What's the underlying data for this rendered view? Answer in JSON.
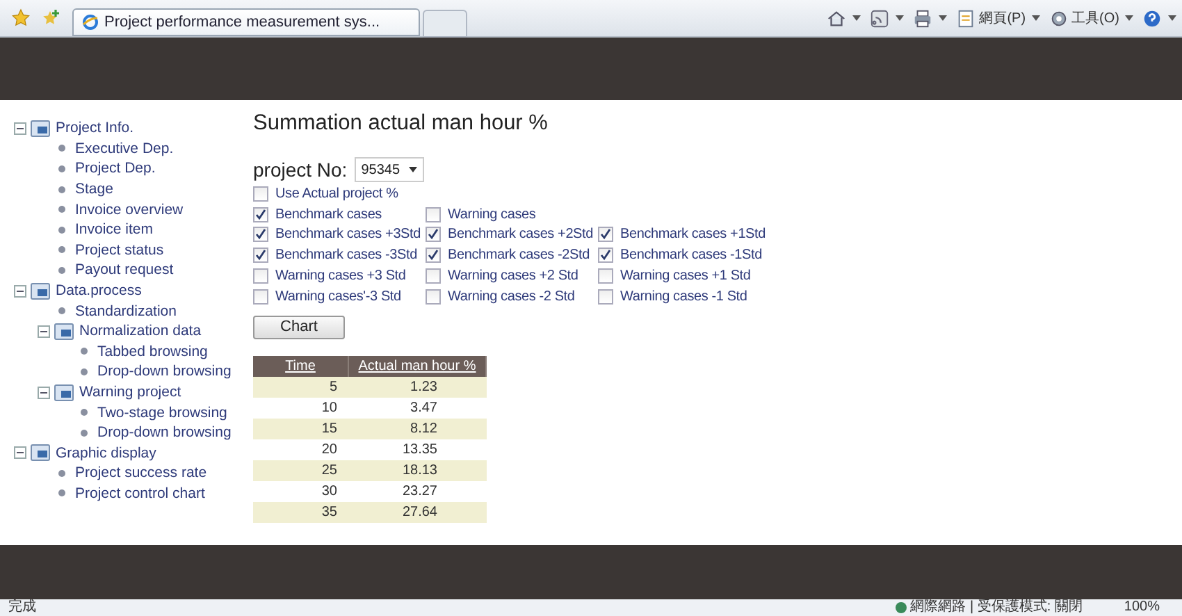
{
  "browser": {
    "tab_title": "Project performance measurement sys...",
    "tools": [
      {
        "kind": "home"
      },
      {
        "kind": "feed"
      },
      {
        "kind": "print"
      },
      {
        "kind": "page",
        "label": "網頁(P)"
      },
      {
        "kind": "tools",
        "label": "工具(O)"
      },
      {
        "kind": "help"
      }
    ]
  },
  "sidebar": {
    "items": [
      {
        "label": "Project Info.",
        "expanded": true,
        "children": [
          {
            "label": "Executive Dep."
          },
          {
            "label": "Project Dep."
          },
          {
            "label": "Stage"
          },
          {
            "label": "Invoice overview"
          },
          {
            "label": "Invoice item"
          },
          {
            "label": "Project status"
          },
          {
            "label": "Payout request"
          }
        ]
      },
      {
        "label": "Data.process",
        "expanded": true,
        "children": [
          {
            "label": "Standardization"
          },
          {
            "label": "Normalization data",
            "expanded": true,
            "children": [
              {
                "label": "Tabbed browsing"
              },
              {
                "label": "Drop-down browsing"
              }
            ]
          },
          {
            "label": "Warning project",
            "expanded": true,
            "children": [
              {
                "label": "Two-stage browsing"
              },
              {
                "label": "Drop-down browsing"
              }
            ]
          }
        ]
      },
      {
        "label": "Graphic display",
        "expanded": true,
        "children": [
          {
            "label": "Project success rate"
          },
          {
            "label": "Project control chart"
          }
        ]
      }
    ]
  },
  "main": {
    "title": "Summation actual man hour %",
    "project_label": "project No:",
    "project_value": "95345",
    "option_rows": [
      [
        {
          "label": "Use Actual project %",
          "checked": false
        }
      ],
      [
        {
          "label": "Benchmark cases",
          "checked": true
        },
        {
          "label": "Warning cases",
          "checked": false
        }
      ],
      [
        {
          "label": "Benchmark cases +3Std",
          "checked": true
        },
        {
          "label": "Benchmark cases +2Std",
          "checked": true
        },
        {
          "label": "Benchmark cases +1Std",
          "checked": true
        }
      ],
      [
        {
          "label": "Benchmark cases -3Std",
          "checked": true
        },
        {
          "label": "Benchmark cases -2Std",
          "checked": true
        },
        {
          "label": "Benchmark cases -1Std",
          "checked": true
        }
      ],
      [
        {
          "label": "Warning cases +3 Std",
          "checked": false
        },
        {
          "label": "Warning cases +2 Std",
          "checked": false
        },
        {
          "label": "Warning cases +1 Std",
          "checked": false
        }
      ],
      [
        {
          "label": "Warning cases'-3 Std",
          "checked": false
        },
        {
          "label": "Warning cases -2 Std",
          "checked": false
        },
        {
          "label": "Warning cases -1 Std",
          "checked": false
        }
      ]
    ],
    "chart_button": "Chart",
    "table": {
      "columns": [
        "Time",
        "Actual man hour %"
      ],
      "rows": [
        [
          "5",
          "1.23"
        ],
        [
          "10",
          "3.47"
        ],
        [
          "15",
          "8.12"
        ],
        [
          "20",
          "13.35"
        ],
        [
          "25",
          "18.13"
        ],
        [
          "30",
          "23.27"
        ],
        [
          "35",
          "27.64"
        ]
      ]
    }
  },
  "status_bar": {
    "left": "完成",
    "zone": "網際網路 | 受保護模式: 關閉",
    "zoom": "100%"
  }
}
